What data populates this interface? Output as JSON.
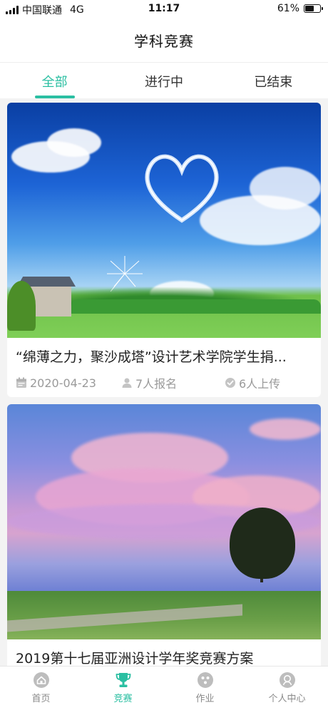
{
  "status_bar": {
    "carrier": "中国联通",
    "network": "4G",
    "time": "11:17",
    "battery_percent": "61%",
    "battery_level": 0.61
  },
  "nav": {
    "title": "学科竞赛"
  },
  "tabs": [
    {
      "label": "全部",
      "active": true
    },
    {
      "label": "进行中",
      "active": false
    },
    {
      "label": "已结束",
      "active": false
    }
  ],
  "competitions": [
    {
      "title": "“绵薄之力，聚沙成塔”设计艺术学院学生捐...",
      "date": "2020-04-23",
      "signups": "7人报名",
      "uploads": "6人上传",
      "image": "sky-heart-cloud-landscape"
    },
    {
      "title": "2019第十七届亚洲设计学年奖竞赛方案",
      "image": "pink-clouds-tree-landscape"
    }
  ],
  "tabbar": [
    {
      "label": "首页",
      "icon": "home-icon",
      "active": false
    },
    {
      "label": "竞赛",
      "icon": "trophy-icon",
      "active": true
    },
    {
      "label": "作业",
      "icon": "homework-icon",
      "active": false
    },
    {
      "label": "个人中心",
      "icon": "profile-icon",
      "active": false
    }
  ],
  "colors": {
    "accent": "#2bbfa2",
    "inactive": "#8a8a8a",
    "meta": "#9a9a9a"
  }
}
